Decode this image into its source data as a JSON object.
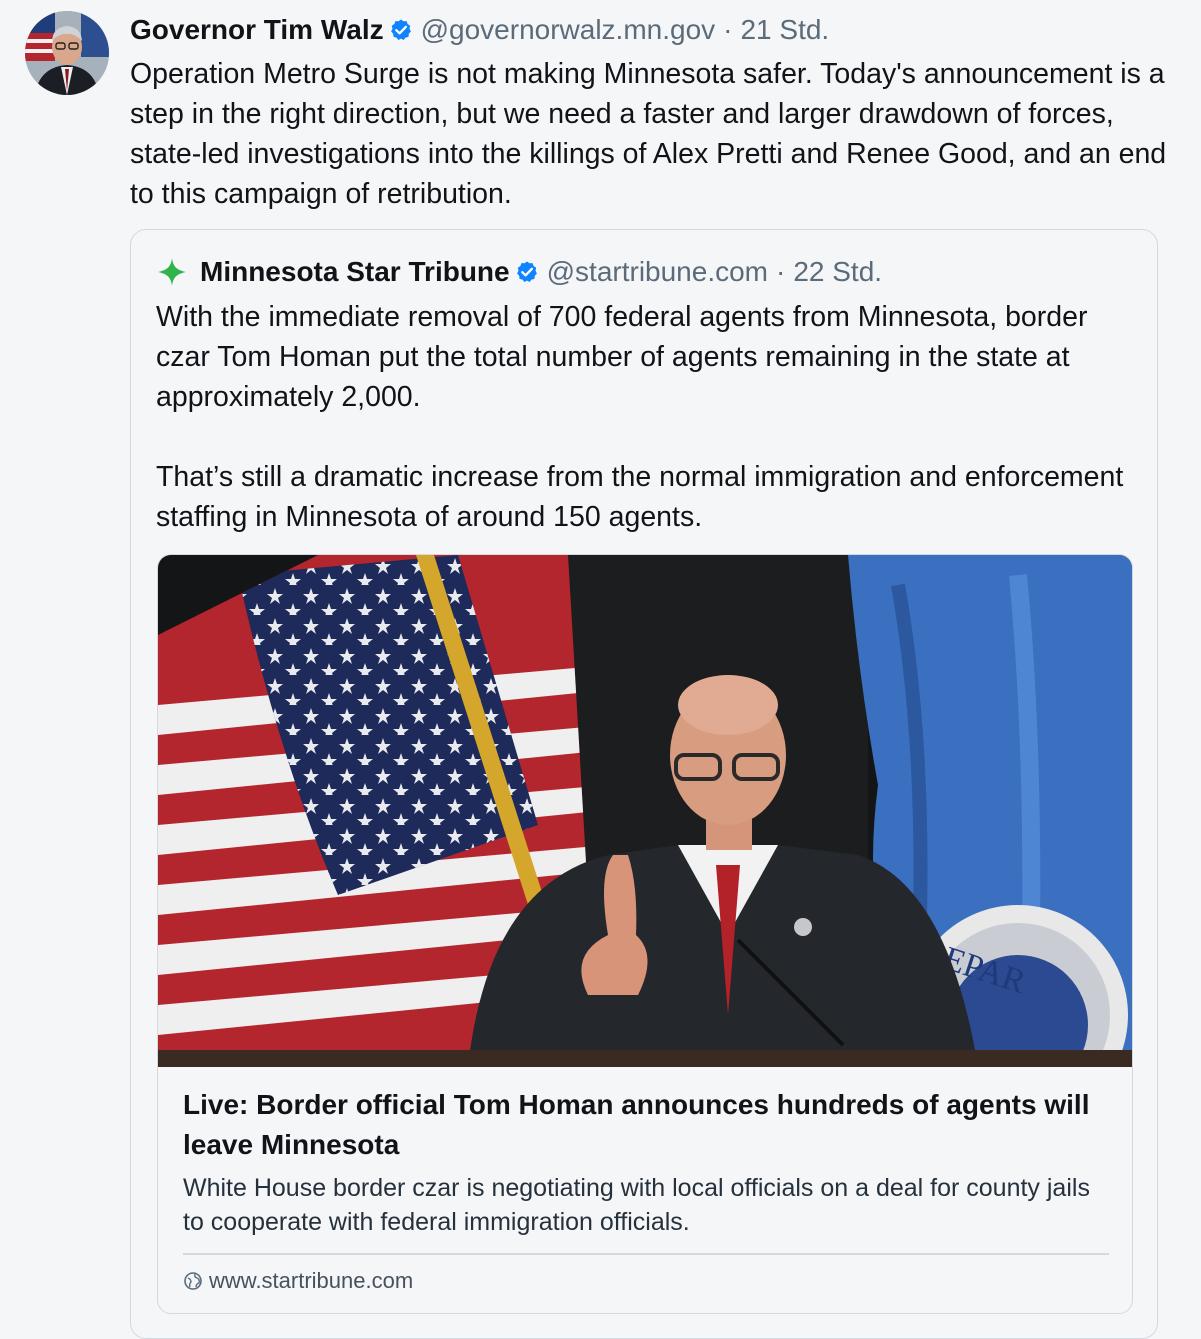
{
  "post": {
    "author_name": "Governor Tim Walz",
    "handle": "@governorwalz.mn.gov",
    "separator": "·",
    "time": "21 Std.",
    "text": "Operation Metro Surge is not making Minnesota safer. Today's announcement is a step in the right direction, but we need a faster and larger drawdown of forces, state-led investigations into the killings of Alex Pretti and Renee Good, and an end to this campaign of retribution."
  },
  "quote": {
    "author_name": "Minnesota Star Tribune",
    "handle": "@startribune.com",
    "separator": "·",
    "time": "22 Std.",
    "text": "With the immediate removal of 700 federal agents from Minnesota, border czar Tom Homan put the total number of agents remaining in the state at approximately 2,000.\n\nThat’s still a dramatic increase from the normal immigration and enforcement staffing in Minnesota of around 150 agents."
  },
  "link_card": {
    "title": "Live: Border official Tom Homan announces hundreds of agents will leave Minnesota",
    "description": "White House border czar is negotiating with local officials on a deal for county jails to cooperate with federal immigration officials.",
    "domain": "www.startribune.com",
    "seal_text": "DEPAR"
  },
  "icons": {
    "verified": "verified-badge-icon",
    "quote_logo": "star-tribune-sparkle-icon",
    "domain": "globe-icon"
  },
  "colors": {
    "background": "#f5f6f8",
    "text": "#101419",
    "muted": "#5c6b7a",
    "verified_blue": "#1083fe",
    "logo_green": "#2fb34c",
    "border": "#d4d9df"
  }
}
